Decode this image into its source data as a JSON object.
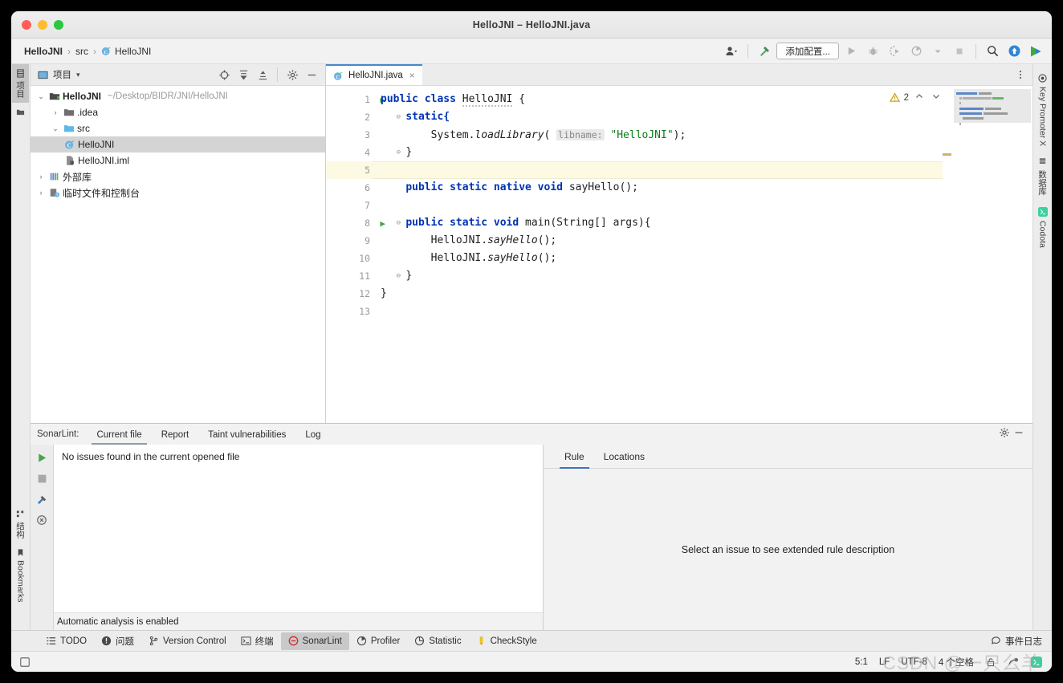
{
  "window": {
    "title": "HelloJNI – HelloJNI.java"
  },
  "breadcrumb": {
    "items": [
      {
        "label": "HelloJNI",
        "bold": true
      },
      {
        "label": "src",
        "bold": false
      },
      {
        "label": "HelloJNI",
        "bold": false
      }
    ],
    "separator": "›"
  },
  "toolbar": {
    "config_label": "添加配置...",
    "icons": {
      "user": "user-dropdown-icon",
      "hammer": "build-hammer-icon",
      "run": "run-icon",
      "debug": "debug-icon",
      "coverage": "run-with-coverage-icon",
      "profile": "profile-icon",
      "stop": "stop-icon",
      "search": "search-everywhere-icon",
      "update": "update-project-icon",
      "play_gradient": "run-anything-icon"
    }
  },
  "left_strip": {
    "project_tab": "项目",
    "structure_tab": "结构",
    "bookmarks_tab": "Bookmarks"
  },
  "right_strip": {
    "items": [
      {
        "label": "Key Promoter X",
        "icon": "key-promoter-icon"
      },
      {
        "label": "数据库",
        "icon": "database-icon"
      },
      {
        "label": "Codota",
        "icon": "codota-icon"
      }
    ]
  },
  "project_panel": {
    "title": "项目",
    "chevron": "▾",
    "icons": [
      "locate-target-icon",
      "expand-all-icon",
      "collapse-all-icon",
      "settings-gear-icon",
      "hide-panel-icon"
    ],
    "tree": [
      {
        "indent": 0,
        "arrow": "⌄",
        "icon": "module-icon",
        "label": "HelloJNI",
        "bold": true,
        "path": "~/Desktop/BIDR/JNI/HelloJNI",
        "selected": false
      },
      {
        "indent": 1,
        "arrow": "›",
        "icon": "folder-icon",
        "label": ".idea",
        "bold": false,
        "path": "",
        "selected": false
      },
      {
        "indent": 1,
        "arrow": "⌄",
        "icon": "source-folder-icon",
        "label": "src",
        "bold": false,
        "path": "",
        "selected": false
      },
      {
        "indent": 2,
        "arrow": "",
        "icon": "java-class-icon",
        "label": "HelloJNI",
        "bold": false,
        "path": "",
        "selected": true
      },
      {
        "indent": 2,
        "arrow": "",
        "icon": "iml-file-icon",
        "label": "HelloJNI.iml",
        "bold": false,
        "path": "",
        "selected": false
      },
      {
        "indent": 0,
        "arrow": "›",
        "icon": "external-libraries-icon",
        "label": "外部库",
        "bold": false,
        "path": "",
        "selected": false
      },
      {
        "indent": 0,
        "arrow": "›",
        "icon": "scratches-icon",
        "label": "临时文件和控制台",
        "bold": false,
        "path": "",
        "selected": false
      }
    ]
  },
  "editor": {
    "tab": {
      "label": "HelloJNI.java",
      "icon": "java-class-icon",
      "close": "×"
    },
    "inspection": {
      "count": "2",
      "icon": "warning-triangle-icon",
      "up": "⌃",
      "down": "⌄"
    },
    "lines": [
      {
        "n": "1",
        "run": true,
        "fold": "",
        "highlight": false
      },
      {
        "n": "2",
        "run": false,
        "fold": "⊖",
        "highlight": false
      },
      {
        "n": "3",
        "run": false,
        "fold": "",
        "highlight": false
      },
      {
        "n": "4",
        "run": false,
        "fold": "⊖",
        "highlight": false
      },
      {
        "n": "5",
        "run": false,
        "fold": "",
        "highlight": true
      },
      {
        "n": "6",
        "run": false,
        "fold": "",
        "highlight": false
      },
      {
        "n": "7",
        "run": false,
        "fold": "",
        "highlight": false
      },
      {
        "n": "8",
        "run": true,
        "fold": "⊖",
        "highlight": false
      },
      {
        "n": "9",
        "run": false,
        "fold": "",
        "highlight": false
      },
      {
        "n": "10",
        "run": false,
        "fold": "",
        "highlight": false
      },
      {
        "n": "11",
        "run": false,
        "fold": "⊖",
        "highlight": false
      },
      {
        "n": "12",
        "run": false,
        "fold": "",
        "highlight": false
      },
      {
        "n": "13",
        "run": false,
        "fold": "",
        "highlight": false
      }
    ],
    "code": {
      "l1_kw1": "public",
      "l1_kw2": "class",
      "l1_name": "HelloJNI",
      "l1_brace": "{",
      "l2": "static{",
      "l3_obj": "System.",
      "l3_method": "loadLibrary",
      "l3_open": "( ",
      "l3_hint": "libname:",
      "l3_str": "\"HelloJNI\"",
      "l3_close": ");",
      "l4": "}",
      "l6_kw": "public static native void",
      "l6_name": "sayHello",
      "l6_rest": "();",
      "l8_kw": "public static void",
      "l8_name": "main",
      "l8_rest": "(String[] args){",
      "l9_obj": "HelloJNI.",
      "l9_method": "sayHello",
      "l9_rest": "();",
      "l10_obj": "HelloJNI.",
      "l10_method": "sayHello",
      "l10_rest": "();",
      "l11": "}",
      "l12": "}"
    }
  },
  "sonarlint": {
    "prefix": "SonarLint:",
    "tabs": [
      {
        "label": "Current file",
        "active": true
      },
      {
        "label": "Report",
        "active": false
      },
      {
        "label": "Taint vulnerabilities",
        "active": false
      },
      {
        "label": "Log",
        "active": false
      }
    ],
    "panel_icons": [
      "settings-gear-icon",
      "hide-panel-icon"
    ],
    "side_buttons": [
      "analyze-run-icon",
      "stop-icon",
      "clean-icon",
      "cancel-icon"
    ],
    "message": "No issues found in the current opened file",
    "status": "Automatic analysis is enabled",
    "rule_tabs": [
      {
        "label": "Rule",
        "active": true
      },
      {
        "label": "Locations",
        "active": false
      }
    ],
    "rule_empty": "Select an issue to see extended rule description"
  },
  "tool_window_bar": {
    "items": [
      {
        "label": "TODO",
        "icon": "todo-icon",
        "active": false
      },
      {
        "label": "问题",
        "icon": "problems-icon",
        "active": false
      },
      {
        "label": "Version Control",
        "icon": "version-control-icon",
        "active": false
      },
      {
        "label": "终端",
        "icon": "terminal-icon",
        "active": false
      },
      {
        "label": "SonarLint",
        "icon": "sonarlint-icon",
        "active": true
      },
      {
        "label": "Profiler",
        "icon": "profiler-icon",
        "active": false
      },
      {
        "label": "Statistic",
        "icon": "statistic-icon",
        "active": false
      },
      {
        "label": "CheckStyle",
        "icon": "checkstyle-icon",
        "active": false
      }
    ],
    "event_log": {
      "label": "事件日志",
      "icon": "event-log-icon"
    }
  },
  "status_bar": {
    "caret": "5:1",
    "line_sep": "LF",
    "encoding": "UTF-8",
    "indent": "4 个空格",
    "lock": "read-only-lock-icon",
    "vcs": "vcs-branch-icon",
    "codota": "codota-status-icon"
  },
  "watermark": "CSDN @一只么羊",
  "colors": {
    "accent_blue": "#3f74c2",
    "keyword": "#0033b3",
    "string": "#067d17",
    "highlight_line": "#fdfae4",
    "selection": "#d4d4d4",
    "sonar_red": "#cb2b2b"
  }
}
